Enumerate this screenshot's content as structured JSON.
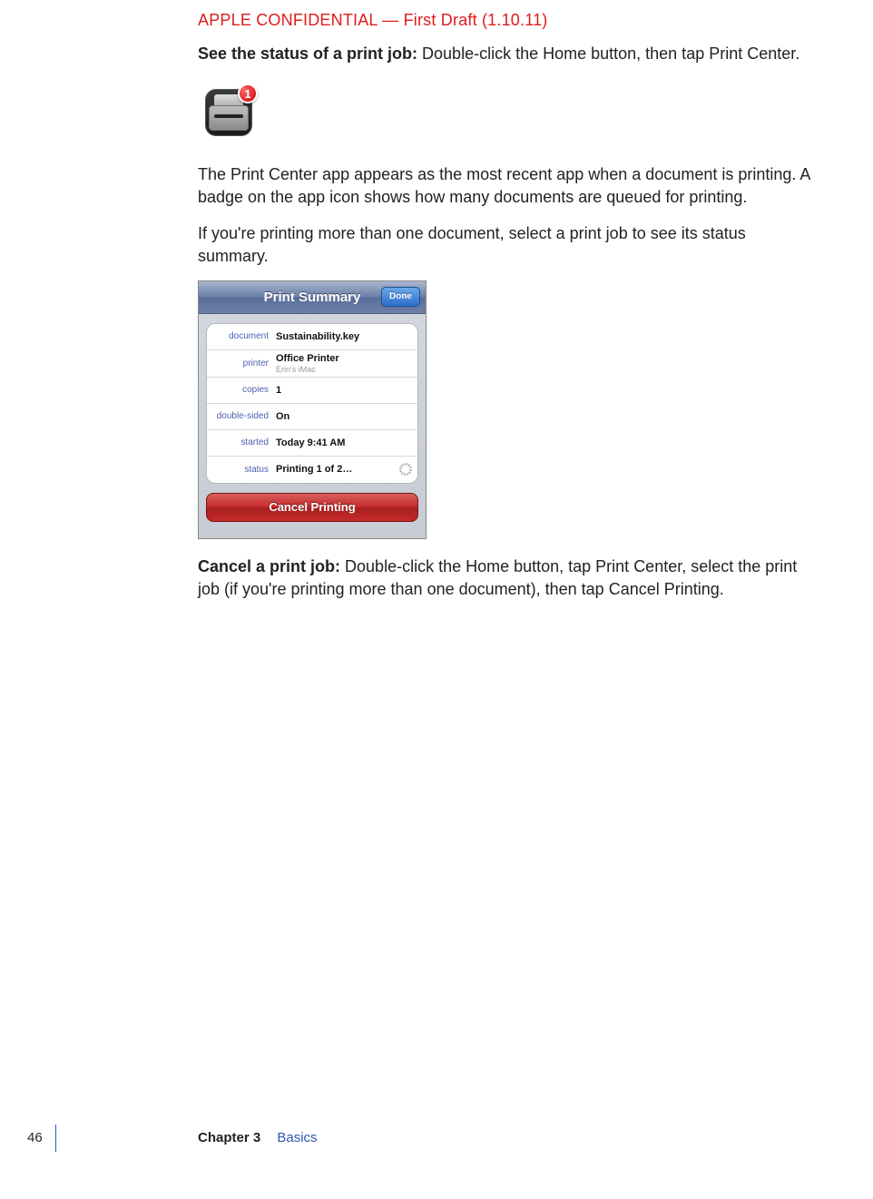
{
  "header": {
    "confidential": "APPLE CONFIDENTIAL — First Draft (1.10.11)"
  },
  "content": {
    "see_status_lead": "See the status of a print job:",
    "see_status_body": "  Double-click the Home button, then tap Print Center.",
    "print_icon_badge": "1",
    "para_app_appears": "The Print Center app appears as the most recent app when a document is printing. A badge on the app icon shows how many documents are queued for printing.",
    "para_if_more": "If you're printing more than one document, select a print job to see its status summary.",
    "cancel_lead": "Cancel a print job:",
    "cancel_body": "  Double-click the Home button, tap Print Center, select the print job (if you're printing more than one document), then tap Cancel Printing."
  },
  "ios_panel": {
    "title": "Print Summary",
    "done_label": "Done",
    "rows": {
      "document": {
        "label": "document",
        "value": "Sustainability.key"
      },
      "printer": {
        "label": "printer",
        "value": "Office Printer",
        "sub": "Erin's iMac"
      },
      "copies": {
        "label": "copies",
        "value": "1"
      },
      "doublesided": {
        "label": "double-sided",
        "value": "On"
      },
      "started": {
        "label": "started",
        "value": "Today 9:41 AM"
      },
      "status": {
        "label": "status",
        "value": "Printing 1 of 2…"
      }
    },
    "cancel_label": "Cancel Printing"
  },
  "footer": {
    "page_number": "46",
    "chapter_label": "Chapter 3",
    "chapter_title": "Basics"
  }
}
